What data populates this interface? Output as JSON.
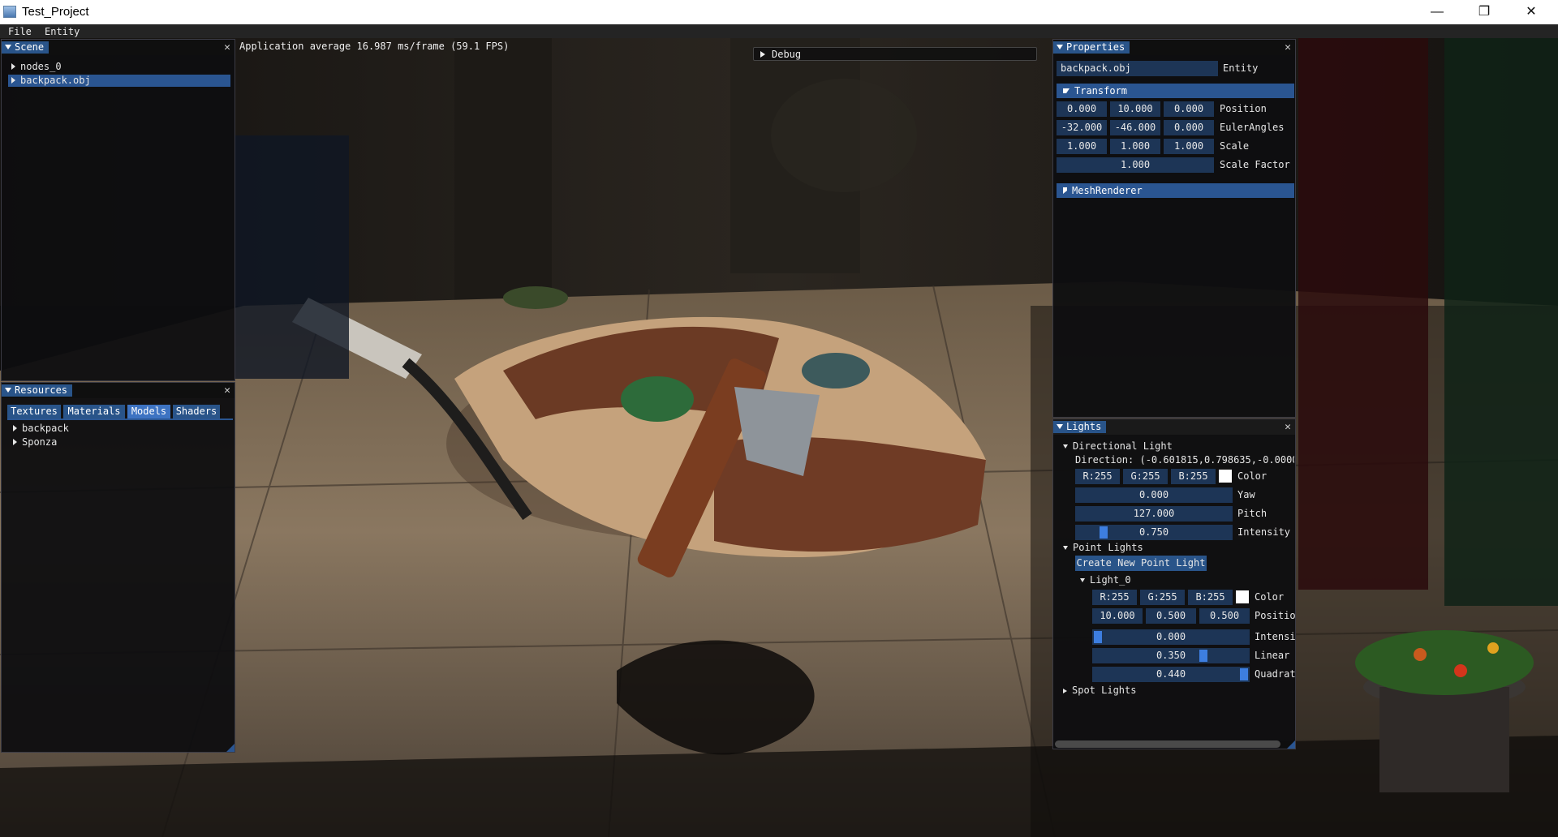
{
  "window": {
    "title": "Test_Project",
    "controls": [
      "—",
      "❐",
      "✕"
    ]
  },
  "menu": {
    "items": [
      "File",
      "Entity"
    ]
  },
  "overlay": {
    "fps_text": "Application average 16.987 ms/frame (59.1 FPS)",
    "debug_label": "Debug"
  },
  "scene_panel": {
    "title": "Scene",
    "items": [
      {
        "label": "nodes_0",
        "selected": false
      },
      {
        "label": "backpack.obj",
        "selected": true
      }
    ]
  },
  "resources_panel": {
    "title": "Resources",
    "tabs": [
      "Textures",
      "Materials",
      "Models",
      "Shaders"
    ],
    "active_tab": "Models",
    "items": [
      "backpack",
      "Sponza"
    ]
  },
  "properties_panel": {
    "title": "Properties",
    "entity_name": "backpack.obj",
    "entity_label": "Entity",
    "transform_header": "Transform",
    "position": {
      "values": [
        "0.000",
        "10.000",
        "0.000"
      ],
      "label": "Position"
    },
    "euler": {
      "values": [
        "-32.000",
        "-46.000",
        "0.000"
      ],
      "label": "EulerAngles"
    },
    "scale": {
      "values": [
        "1.000",
        "1.000",
        "1.000"
      ],
      "label": "Scale"
    },
    "scale_factor": {
      "value": "1.000",
      "label": "Scale Factor"
    },
    "mesh_renderer_header": "MeshRenderer"
  },
  "lights_panel": {
    "title": "Lights",
    "directional": {
      "header": "Directional Light",
      "direction_text": "Direction: (-0.601815,0.798635,-0.00000",
      "color": [
        "R:255",
        "G:255",
        "B:255"
      ],
      "color_label": "Color",
      "yaw": {
        "value": "0.000",
        "label": "Yaw"
      },
      "pitch": {
        "value": "127.000",
        "label": "Pitch"
      },
      "intensity": {
        "value": "0.750",
        "label": "Intensity",
        "slider_fraction": 0.15
      }
    },
    "point_lights": {
      "header": "Point Lights",
      "create_button": "Create New Point Light",
      "light": {
        "name": "Light_0",
        "color": [
          "R:255",
          "G:255",
          "B:255"
        ],
        "color_label": "Color",
        "position": {
          "values": [
            "10.000",
            "0.500",
            "0.500"
          ],
          "label": "Positio"
        },
        "intensity": {
          "value": "0.000",
          "label": "Intensi",
          "slider_fraction": 0.0
        },
        "linear": {
          "value": "0.350",
          "label": "Linear",
          "slider_fraction": 0.7
        },
        "quadratic": {
          "value": "0.440",
          "label": "Quadrat",
          "slider_fraction": 1.0
        }
      }
    },
    "spot_lights_header": "Spot Lights"
  },
  "colors": {
    "accent": "#295489",
    "field_bg": "#1d3556",
    "slider_grab": "#3d7ee0",
    "panel_bg": "#0e0e10"
  }
}
